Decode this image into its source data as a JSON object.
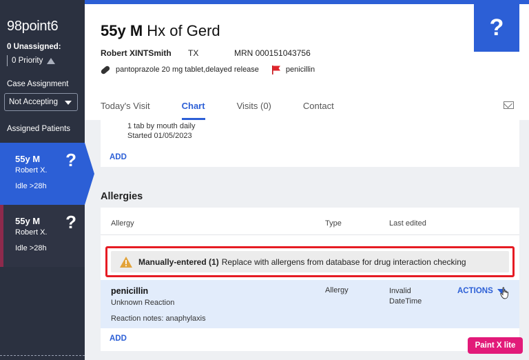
{
  "sidebar": {
    "logo": "98point6",
    "unassigned": "0 Unassigned:",
    "priority": "0 Priority",
    "case_assignment_label": "Case Assignment",
    "case_assignment_value": "Not Accepting",
    "assigned_patients_label": "Assigned Patients",
    "patients": [
      {
        "age_sex": "55y M",
        "name": "Robert X.",
        "idle": "Idle >28h",
        "status": "?"
      },
      {
        "age_sex": "55y M",
        "name": "Robert X.",
        "idle": "Idle >28h",
        "status": "?"
      }
    ]
  },
  "header": {
    "title_bold": "55y M",
    "title_rest": "Hx of Gerd",
    "patient_name": "Robert XINTSmith",
    "state": "TX",
    "mrn": "MRN 000151043756",
    "medication": "pantoprazole 20 mg tablet,delayed release",
    "allergy_flag_text": "penicillin",
    "help_symbol": "?"
  },
  "tabs": [
    {
      "label": "Today's Visit"
    },
    {
      "label": "Chart"
    },
    {
      "label": "Visits (0)"
    },
    {
      "label": "Contact"
    }
  ],
  "medications_card": {
    "dose": "1 tab by mouth daily",
    "started": "Started 01/05/2023",
    "add_label": "ADD"
  },
  "allergies": {
    "heading": "Allergies",
    "columns": [
      "Allergy",
      "Type",
      "Last edited"
    ],
    "warning_bold": "Manually-entered (1)",
    "warning_text": "Replace with allergens from database for drug interaction checking",
    "rows": [
      {
        "name": "penicillin",
        "reaction": "Unknown Reaction",
        "notes": "Reaction notes: anaphylaxis",
        "type": "Allergy",
        "last_edited": "Invalid DateTime",
        "actions_label": "ACTIONS"
      }
    ],
    "add_label": "ADD"
  },
  "colors": {
    "accent": "#2c5fd6",
    "sidebar_bg": "#2b3140",
    "warning_border": "#e61b23",
    "warning_icon": "#e2a33a",
    "watermark": "#e21a79"
  },
  "watermark": "Paint X lite"
}
